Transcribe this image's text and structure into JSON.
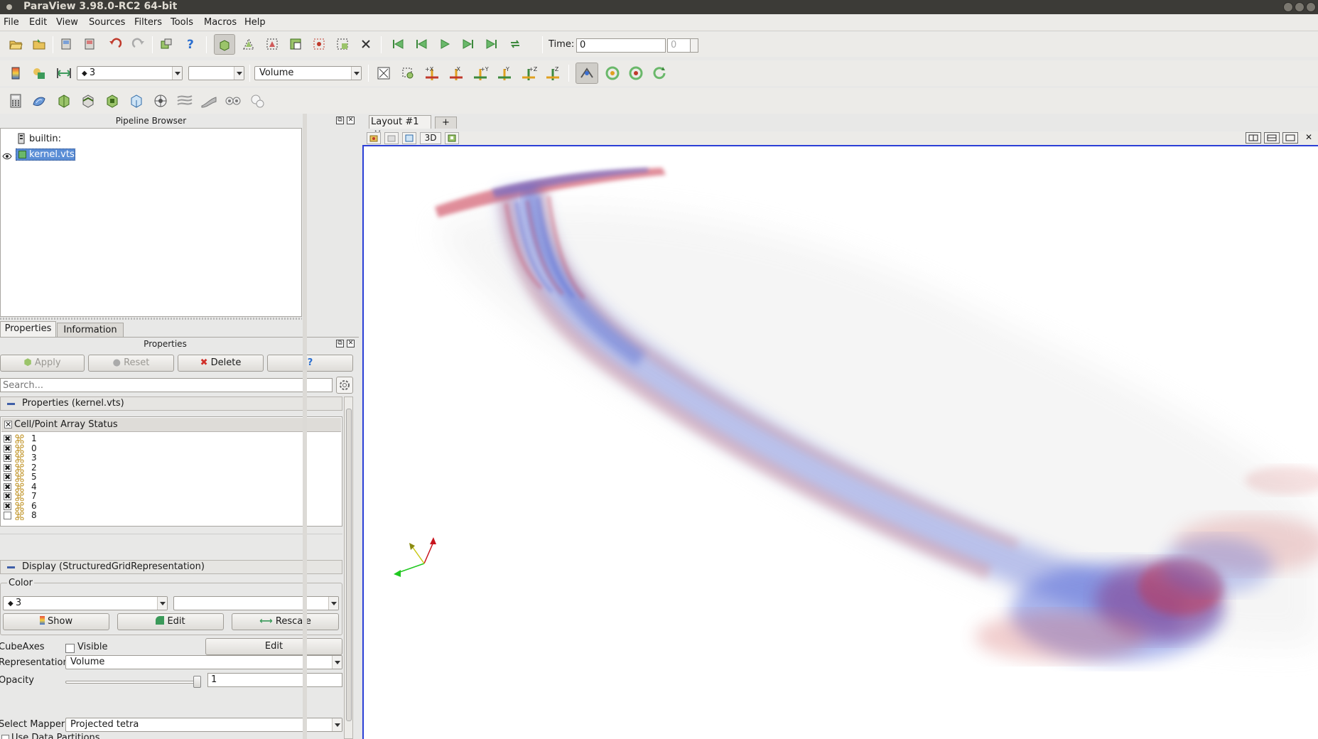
{
  "window": {
    "title": "ParaView 3.98.0-RC2 64-bit"
  },
  "menubar": {
    "items": [
      "File",
      "Edit",
      "View",
      "Sources",
      "Filters",
      "Tools",
      "Macros",
      "Help"
    ]
  },
  "toolbar1": {
    "time_label": "Time:",
    "time_value": "0",
    "timestep_value": "0"
  },
  "toolbar2": {
    "array_combo": "3",
    "component_combo": "",
    "representation_combo": "Volume"
  },
  "pipeline_browser": {
    "title": "Pipeline Browser",
    "items": [
      {
        "label": "builtin:"
      },
      {
        "label": "kernel.vts",
        "selected": true,
        "visible": true
      }
    ]
  },
  "tabs": {
    "properties": "Properties",
    "information": "Information"
  },
  "properties_panel": {
    "title": "Properties",
    "apply": "Apply",
    "reset": "Reset",
    "delete": "Delete",
    "help": "?",
    "search_placeholder": "Search...",
    "section_properties": "Properties (kernel.vts)",
    "array_status_header": "Cell/Point Array Status",
    "arrays": [
      {
        "name": "1",
        "checked": true
      },
      {
        "name": "0",
        "checked": true
      },
      {
        "name": "3",
        "checked": true
      },
      {
        "name": "2",
        "checked": true
      },
      {
        "name": "5",
        "checked": true
      },
      {
        "name": "4",
        "checked": true
      },
      {
        "name": "7",
        "checked": true
      },
      {
        "name": "6",
        "checked": true
      },
      {
        "name": "8",
        "checked": false
      }
    ],
    "section_display": "Display (StructuredGridRepresentation)",
    "color_group": "Color",
    "color_array": "3",
    "color_component": "",
    "show_button": "Show",
    "edit_button": "Edit",
    "rescale_button": "Rescale",
    "cubeaxes_label": "CubeAxes",
    "cubeaxes_visible_label": "Visible",
    "cubeaxes_edit": "Edit",
    "representation_label": "Representation",
    "representation_value": "Volume",
    "opacity_label": "Opacity",
    "opacity_value": "1",
    "opacity_slider": 1.0,
    "mapper_label": "Select Mapper",
    "mapper_value": "Projected tetra",
    "partitions_label": "Use Data Partitions"
  },
  "view": {
    "layout_tab": "Layout #1",
    "add_tab": "+",
    "mode_3d": "3D"
  },
  "colors": {
    "accent_blue": "#2b3fd6",
    "selection": "#5b8ed6",
    "volume_red": "#c8324a",
    "volume_blue": "#4a5fd6"
  }
}
